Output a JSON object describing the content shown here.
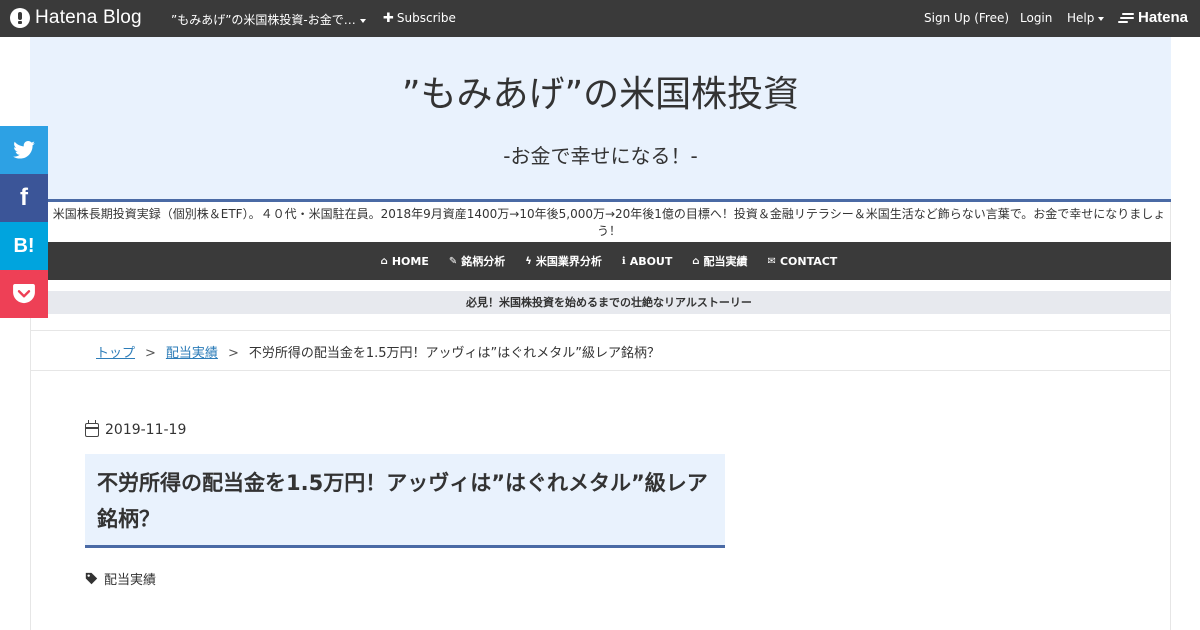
{
  "topbar": {
    "logo_text": "Hatena Blog",
    "blog_title": "”もみあげ”の米国株投資-お金で…",
    "subscribe_label": "Subscribe",
    "signup_label": "Sign Up (Free)",
    "login_label": "Login",
    "help_label": "Help",
    "hatena_label": "Hatena"
  },
  "header": {
    "title": "”もみあげ”の米国株投資",
    "subtitle": "-お金で幸せになる！-"
  },
  "description": "米国株長期投資実録（個別株＆ETF）。４０代・米国駐在員。2018年9月資産1400万→10年後5,000万→20年後1億の目標へ！投資＆金融リテラシー＆米国生活など飾らない言葉で。お金で幸せになりましょう！",
  "nav": [
    {
      "icon": "home-icon",
      "glyph": "⌂",
      "label": "HOME"
    },
    {
      "icon": "wrench-icon",
      "glyph": "✎",
      "label": "銘柄分析"
    },
    {
      "icon": "bolt-icon",
      "glyph": "ϟ",
      "label": "米国業界分析"
    },
    {
      "icon": "info-icon",
      "glyph": "ℹ",
      "label": "ABOUT"
    },
    {
      "icon": "graduation-cap-icon",
      "glyph": "⌂",
      "label": "配当実績"
    },
    {
      "icon": "envelope-icon",
      "glyph": "✉",
      "label": "CONTACT"
    }
  ],
  "notice": "必見！米国株投資を始めるまでの壮絶なリアルストーリー",
  "breadcrumb": {
    "top": "トップ",
    "separator": ">",
    "category": "配当実績",
    "current": "不労所得の配当金を1.5万円！アッヴィは”はぐれメタル”級レア銘柄？"
  },
  "article": {
    "date": "2019-11-19",
    "title": "不労所得の配当金を1.5万円！アッヴィは”はぐれメタル”級レア銘柄？",
    "category": "配当実績"
  },
  "colors": {
    "topbar": "#3a3a3a",
    "header_bg": "#e9f2fd",
    "accent": "#4a6aa5",
    "twitter": "#2da1e4",
    "facebook": "#3b5598",
    "hatebu": "#00a4de",
    "pocket": "#ee4056"
  },
  "share": {
    "hatebu_label": "B!",
    "facebook_label": "f"
  }
}
